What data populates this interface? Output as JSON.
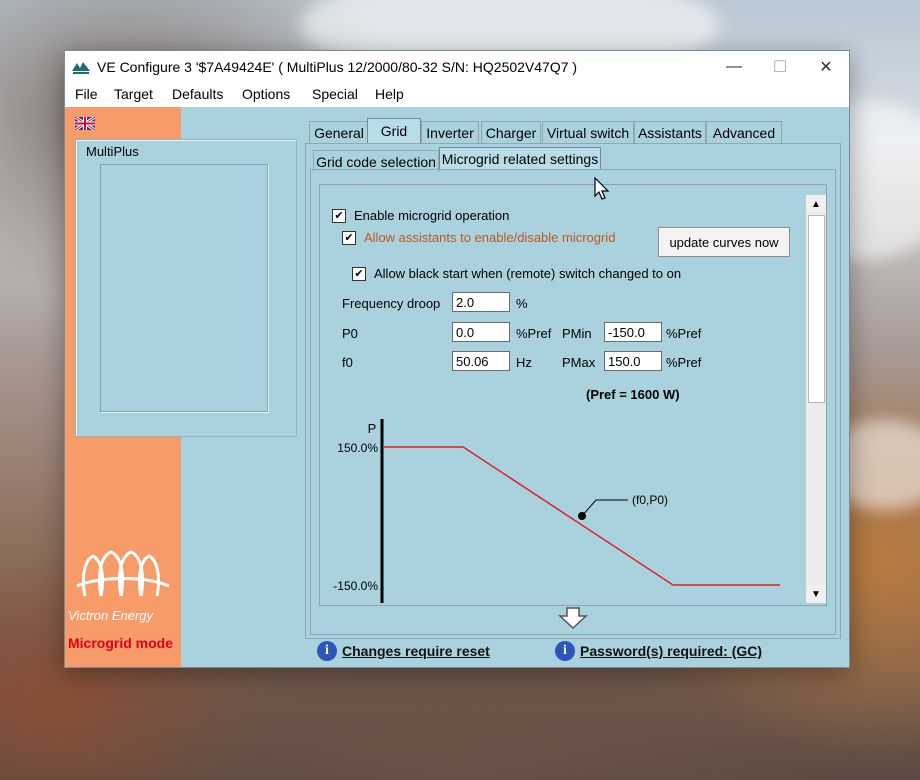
{
  "window": {
    "title": "VE Configure 3   '$7A49424E' ( MultiPlus 12/2000/80-32 S/N: HQ2502V47Q7 )",
    "controls": {
      "minimize": "—",
      "maximize": "☐",
      "close": "✕"
    }
  },
  "menu": [
    "File",
    "Target",
    "Defaults",
    "Options",
    "Special",
    "Help"
  ],
  "sidebar": {
    "device_panel_title": "MultiPlus",
    "logo_text": "Victron Energy",
    "mode_text": "Microgrid mode"
  },
  "tabs": [
    "General",
    "Grid",
    "Inverter",
    "Charger",
    "Virtual switch",
    "Assistants",
    "Advanced"
  ],
  "active_tab": "Grid",
  "subtabs": [
    "Grid code selection",
    "Microgrid related settings"
  ],
  "active_subtab": "Microgrid related settings",
  "settings": {
    "enable_microgrid": {
      "label": "Enable microgrid operation",
      "checked": "✔"
    },
    "allow_assistants": {
      "label": "Allow assistants to enable/disable microgrid",
      "checked": "✔"
    },
    "allow_black_start": {
      "label": "Allow black start when (remote) switch changed to on",
      "checked": "✔"
    },
    "update_curves_button": "update curves now",
    "frequency_droop": {
      "label": "Frequency droop",
      "value": "2.0",
      "unit": "%"
    },
    "p0": {
      "label": "P0",
      "value": "0.0",
      "unit": "%Pref"
    },
    "f0": {
      "label": "f0",
      "value": "50.06",
      "unit": "Hz"
    },
    "pmin": {
      "label": "PMin",
      "value": "-150.0",
      "unit": "%Pref"
    },
    "pmax": {
      "label": "PMax",
      "value": "150.0",
      "unit": "%Pref"
    },
    "pref_note": "(Pref = 1600 W)"
  },
  "chart_data": {
    "type": "line",
    "title": "",
    "xlabel": "",
    "ylabel": "P",
    "ylim": [
      -150,
      150
    ],
    "tick_labels": [
      "150.0%",
      "-150.0%"
    ],
    "series": [
      {
        "x": [
          0.0,
          0.2,
          0.73,
          1.0
        ],
        "y": [
          150,
          150,
          -150,
          -150
        ]
      }
    ],
    "annotation": {
      "label": "(f0,P0)",
      "x": 0.5,
      "y": 0
    },
    "line_color": "#e0241b"
  },
  "status": {
    "reset_text": "Changes require reset",
    "password_text": "Password(s) required: (GC)",
    "info_glyph": "i"
  }
}
